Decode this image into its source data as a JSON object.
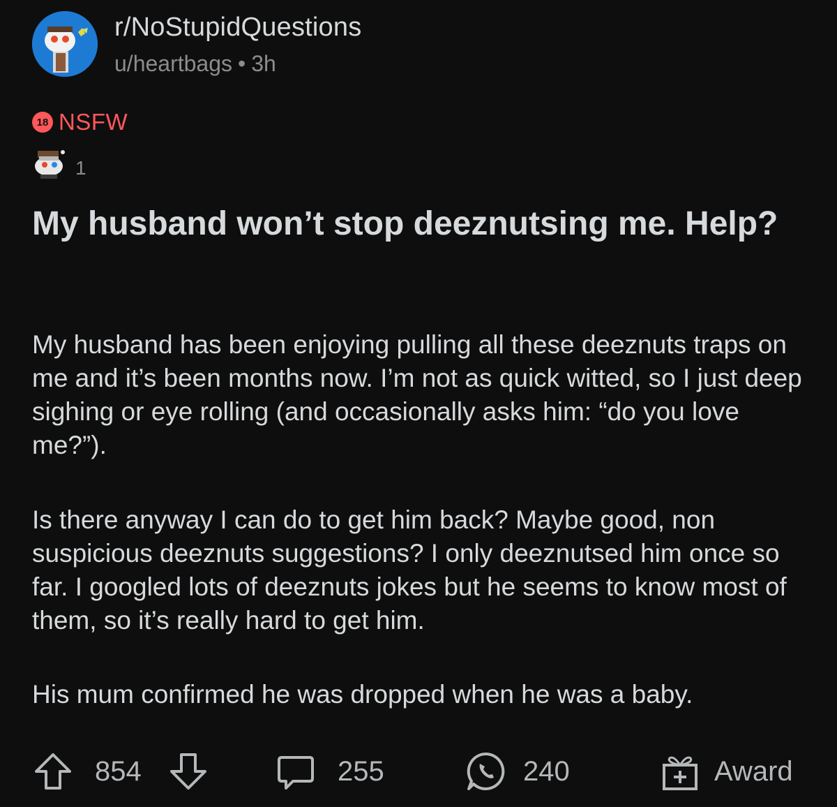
{
  "header": {
    "subreddit": "r/NoStupidQuestions",
    "author": "u/heartbags",
    "separator": "•",
    "time_ago": "3h"
  },
  "nsfw": {
    "badge": "18",
    "label": "NSFW"
  },
  "awards": {
    "count": "1"
  },
  "post": {
    "title": "My husband won’t stop deeznutsing me. Help?",
    "paragraphs": [
      "My husband has been enjoying pulling all these deeznuts traps on me and it’s been months now. I’m not as quick witted, so I just deep sighing or eye rolling (and occasionally asks him: “do you love me?”).",
      "Is there anyway I can do to get him back? Maybe good, non suspicious deeznuts suggestions? I only deeznutsed him once so far. I googled lots of deeznuts jokes but he seems to know most of them, so it’s really hard to get him.",
      "His mum confirmed he was dropped when he was a baby."
    ]
  },
  "actions": {
    "score": "854",
    "comments": "255",
    "shares": "240",
    "award_label": "Award"
  },
  "colors": {
    "background": "#0e0e0e",
    "text": "#d7dadc",
    "muted": "#8a8c8e",
    "nsfw": "#ff585b",
    "avatar_bg": "#1e7bd4"
  },
  "icons": [
    "subreddit-avatar",
    "award-icon",
    "upvote-icon",
    "downvote-icon",
    "comment-icon",
    "share-icon",
    "gift-icon"
  ]
}
